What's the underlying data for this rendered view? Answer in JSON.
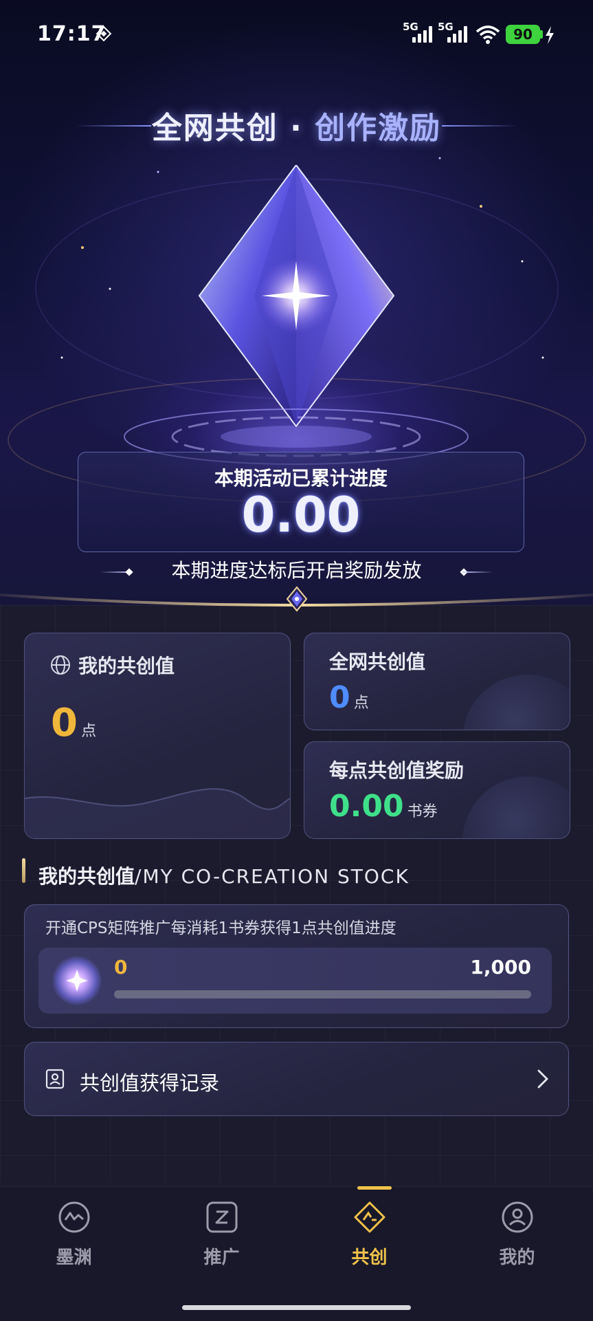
{
  "status_bar": {
    "time": "17:17",
    "network_1": "5G",
    "network_2": "5G",
    "battery": "90",
    "icons": [
      "system-glyph-icon",
      "signal-icon",
      "wifi-icon",
      "battery-icon",
      "charging-icon"
    ]
  },
  "hero": {
    "title_main": "全网共创",
    "title_sep": " · ",
    "title_accent": "创作激励",
    "progress_label": "本期活动已累计进度",
    "progress_value": "0.00",
    "note": "本期进度达标后开启奖励发放"
  },
  "cards": {
    "my_value": {
      "title": "我的共创值",
      "value": "0",
      "unit": "点"
    },
    "network_value": {
      "title": "全网共创值",
      "value": "0",
      "unit": "点"
    },
    "reward": {
      "title": "每点共创值奖励",
      "value": "0.00",
      "unit": "书券"
    }
  },
  "stock": {
    "heading": "我的共创值",
    "heading_en": "/MY CO-CREATION STOCK",
    "description": "开通CPS矩阵推广每消耗1书券获得1点共创值进度",
    "current": "0",
    "max": "1,000",
    "progress_fraction": 0
  },
  "record": {
    "label": "共创值获得记录"
  },
  "nav": {
    "items": [
      {
        "label": "墨渊",
        "icon": "wave-circle-icon"
      },
      {
        "label": "推广",
        "icon": "z-square-icon"
      },
      {
        "label": "共创",
        "icon": "co-create-icon",
        "active": true
      },
      {
        "label": "我的",
        "icon": "profile-icon"
      }
    ]
  },
  "colors": {
    "accent_gold": "#f0b73a",
    "accent_green": "#3fe08a",
    "accent_blue": "#4f8cff",
    "nav_active": "#f0c24a"
  }
}
